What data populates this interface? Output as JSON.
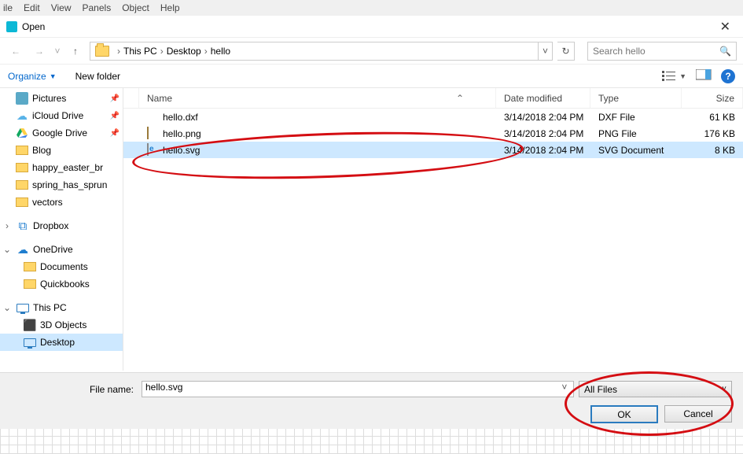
{
  "menubar": {
    "items": [
      "ile",
      "Edit",
      "View",
      "Panels",
      "Object",
      "Help"
    ]
  },
  "dialog": {
    "title": "Open"
  },
  "breadcrumb": {
    "parts": [
      "This PC",
      "Desktop",
      "hello"
    ]
  },
  "search": {
    "placeholder": "Search hello"
  },
  "toolbar": {
    "organize": "Organize",
    "newfolder": "New folder"
  },
  "tree": {
    "pinned": [
      {
        "name": "Pictures",
        "icon": "pictures",
        "pin": true
      },
      {
        "name": "iCloud Drive",
        "icon": "icloud",
        "pin": true
      },
      {
        "name": "Google Drive",
        "icon": "gdrive",
        "pin": true
      },
      {
        "name": "Blog",
        "icon": "folder",
        "pin": false
      },
      {
        "name": "happy_easter_br",
        "icon": "folder",
        "pin": false
      },
      {
        "name": "spring_has_sprun",
        "icon": "folder",
        "pin": false
      },
      {
        "name": "vectors",
        "icon": "folder",
        "pin": false
      }
    ],
    "dropbox": "Dropbox",
    "onedrive": "OneDrive",
    "onedriveitems": [
      {
        "name": "Documents"
      },
      {
        "name": "Quickbooks"
      }
    ],
    "thispc": "This PC",
    "pcitems": [
      {
        "name": "3D Objects",
        "icon": "3d"
      },
      {
        "name": "Desktop",
        "icon": "desktop",
        "selected": true
      }
    ]
  },
  "columns": {
    "name": "Name",
    "date": "Date modified",
    "type": "Type",
    "size": "Size"
  },
  "files": [
    {
      "name": "hello.dxf",
      "date": "3/14/2018 2:04 PM",
      "type": "DXF File",
      "size": "61 KB",
      "icon": "dxf"
    },
    {
      "name": "hello.png",
      "date": "3/14/2018 2:04 PM",
      "type": "PNG File",
      "size": "176 KB",
      "icon": "png"
    },
    {
      "name": "hello.svg",
      "date": "3/14/2018 2:04 PM",
      "type": "SVG Document",
      "size": "8 KB",
      "icon": "svg",
      "selected": true
    }
  ],
  "footer": {
    "fn_label": "File name:",
    "fn_value": "hello.svg",
    "filter": "All Files",
    "ok": "OK",
    "cancel": "Cancel"
  }
}
